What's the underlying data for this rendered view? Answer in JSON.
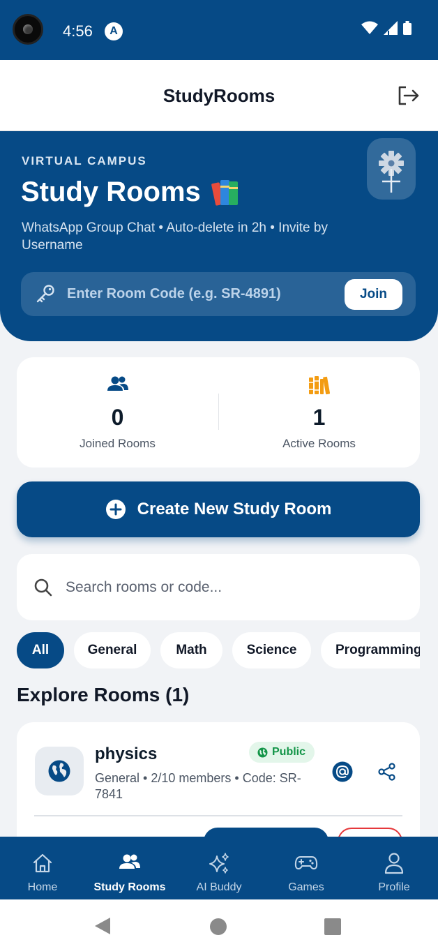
{
  "status_bar": {
    "time": "4:56",
    "notification_letter": "A"
  },
  "app_bar": {
    "title": "StudyRooms"
  },
  "hero": {
    "eyebrow": "VIRTUAL CAMPUS",
    "title": "Study Rooms",
    "subtitle": "WhatsApp Group Chat • Auto-delete in 2h • Invite by Username",
    "code_placeholder": "Enter Room Code (e.g. SR-4891)",
    "join_label": "Join"
  },
  "stats": [
    {
      "value": "0",
      "label": "Joined Rooms",
      "icon": "people-icon"
    },
    {
      "value": "1",
      "label": "Active Rooms",
      "icon": "books-icon"
    }
  ],
  "create_button_label": "Create New Study Room",
  "search": {
    "placeholder": "Search rooms or code..."
  },
  "filters": [
    "All",
    "General",
    "Math",
    "Science",
    "Programming"
  ],
  "active_filter": "All",
  "section_title": "Explore Rooms (1)",
  "rooms": [
    {
      "name": "physics",
      "badge": "Public",
      "meta": "General • 2/10 members • Code: SR-7841",
      "icon": "globe-icon"
    }
  ],
  "bottom_nav": [
    {
      "label": "Home",
      "icon": "home-icon"
    },
    {
      "label": "Study Rooms",
      "icon": "people-icon"
    },
    {
      "label": "AI Buddy",
      "icon": "sparkles-icon"
    },
    {
      "label": "Games",
      "icon": "gamepad-icon"
    },
    {
      "label": "Profile",
      "icon": "person-icon"
    }
  ],
  "active_nav": "Study Rooms",
  "colors": {
    "primary": "#064a86",
    "accent_orange": "#f39c12",
    "public_green": "#139548",
    "danger": "#e5383b"
  }
}
